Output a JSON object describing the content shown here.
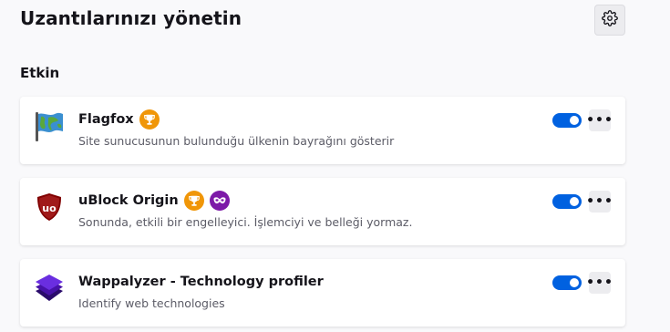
{
  "header": {
    "title": "Uzantılarınızı yönetin",
    "settings_icon": "gear-icon"
  },
  "section": {
    "title": "Etkin"
  },
  "extensions": [
    {
      "name": "Flagfox",
      "description": "Site sunucusunun bulunduğu ülkenin bayrağını gösterir",
      "icon": "flag-globe-icon",
      "badges": [
        "recommended-trophy-icon"
      ],
      "enabled": true
    },
    {
      "name": "uBlock Origin",
      "description": "Sonunda, etkili bir engelleyici. İşlemciyi ve belleği yormaz.",
      "icon": "ublock-shield-icon",
      "badges": [
        "recommended-trophy-icon",
        "private-browsing-mask-icon"
      ],
      "enabled": true
    },
    {
      "name": "Wappalyzer - Technology profiler",
      "description": "Identify web technologies",
      "icon": "wappalyzer-layers-icon",
      "badges": [],
      "enabled": true
    }
  ],
  "colors": {
    "toggle_on": "#0061e0",
    "recommended_badge": "#f09608",
    "private_badge": "#7d1aa8"
  }
}
